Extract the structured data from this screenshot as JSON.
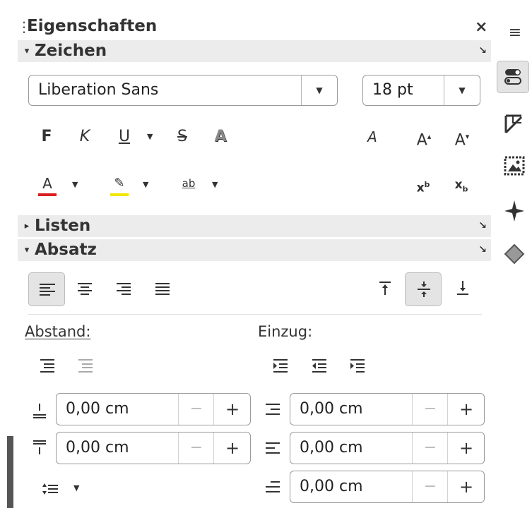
{
  "panel": {
    "title": "Eigenschaften",
    "close": "×",
    "grip": "⋮"
  },
  "sections": {
    "zeichen": {
      "label": "Zeichen",
      "tri": "▾",
      "more": "↘"
    },
    "listen": {
      "label": "Listen",
      "tri": "▸",
      "more": "↘"
    },
    "absatz": {
      "label": "Absatz",
      "tri": "▾",
      "more": "↘"
    }
  },
  "font": {
    "name": "Liberation Sans",
    "size": "18 pt",
    "dropdown": "▼"
  },
  "format_icons": {
    "bold": "F",
    "italic": "K",
    "underline": "U",
    "strike": "S",
    "shadow": "A",
    "clear": "A",
    "grow": "A",
    "shrink": "A",
    "super": "x",
    "super_sup": "b",
    "sub": "x",
    "sub_sub": "b",
    "font_color": "A",
    "highlight": "✎",
    "spacing": "ab"
  },
  "paragraph": {
    "abstand_label": "Abstand:",
    "einzug_label": "Einzug:",
    "spacing_above": "0,00 cm",
    "spacing_below": "0,00 cm",
    "indent_before": "0,00 cm",
    "indent_after": "0,00 cm",
    "indent_first": "0,00 cm",
    "minus": "−",
    "plus": "+"
  },
  "sidebar": {
    "menu": "≡"
  },
  "colors": {
    "font_color_bar": "#d9201f",
    "highlight_bar": "#f0e600",
    "section_bg": "#ececec",
    "active_button": "#e4e4e4"
  }
}
